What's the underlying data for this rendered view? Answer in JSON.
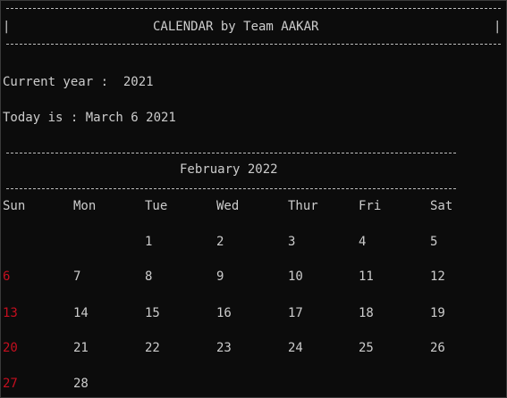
{
  "header": {
    "left_bar": "|",
    "title": "CALENDAR by Team AAKAR",
    "right_bar": "|"
  },
  "info": {
    "current_year": "Current year :  2021",
    "today": "Today is : March 6 2021"
  },
  "calendar": {
    "month_title": "February 2022",
    "weekdays": [
      "Sun",
      "Mon",
      "Tue",
      "Wed",
      "Thur",
      "Fri",
      "Sat"
    ],
    "weeks": [
      [
        "",
        "",
        "1",
        "2",
        "3",
        "4",
        "5"
      ],
      [
        "6",
        "7",
        "8",
        "9",
        "10",
        "11",
        "12"
      ],
      [
        "13",
        "14",
        "15",
        "16",
        "17",
        "18",
        "19"
      ],
      [
        "20",
        "21",
        "22",
        "23",
        "24",
        "25",
        "26"
      ],
      [
        "27",
        "28",
        "",
        "",
        "",
        "",
        ""
      ]
    ],
    "sunday_color": "#c50f1f",
    "text_color": "#cccccc",
    "background": "#0c0c0c"
  }
}
